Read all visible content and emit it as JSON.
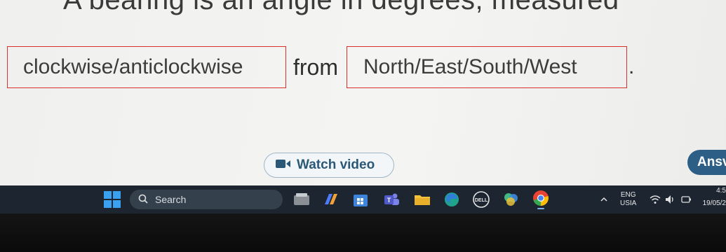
{
  "question": {
    "heading": "A bearing is an angle in degrees, measured",
    "blank1": "clockwise/anticlockwise",
    "connector": "from",
    "blank2": "North/East/South/West",
    "period": "."
  },
  "buttons": {
    "watch_video": "Watch video",
    "answer": "Ansv"
  },
  "taskbar": {
    "search_placeholder": "Search",
    "language": "ENG",
    "region": "USIA",
    "time": "4:5",
    "date": "19/05/2"
  },
  "colors": {
    "blank_border": "#d9302c",
    "watch_text": "#2b5876",
    "answer_bg": "#2d5f86",
    "taskbar_bg": "#1d2530"
  },
  "icons": [
    "windows-icon",
    "search-icon",
    "file-explorer-icon",
    "copilot-icon",
    "microsoft-store-icon",
    "teams-icon",
    "folder-icon",
    "edge-icon",
    "dell-icon",
    "photos-icon",
    "chrome-icon",
    "chevron-up-icon",
    "wifi-icon",
    "volume-icon",
    "battery-icon",
    "video-camera-icon"
  ]
}
